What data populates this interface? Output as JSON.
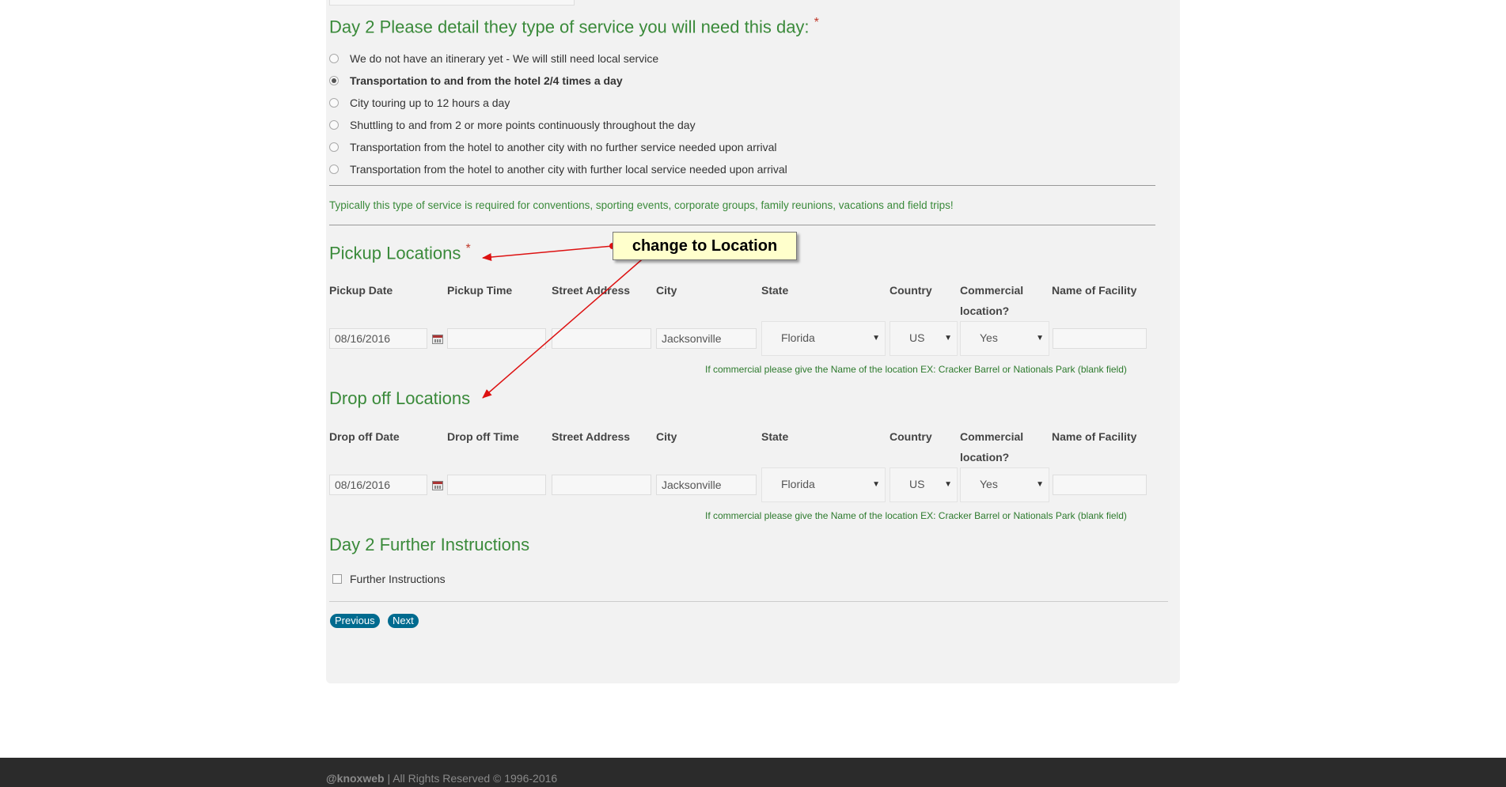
{
  "day_question": {
    "title": "Day 2 Please detail they type of service you will need this day:",
    "required_mark": "*",
    "options": [
      {
        "label": "We do not have an itinerary yet - We will still need local service",
        "selected": false
      },
      {
        "label": "Transportation to and from the hotel 2/4 times a day",
        "selected": true
      },
      {
        "label": "City touring up to 12 hours a day",
        "selected": false
      },
      {
        "label": "Shuttling to and from 2 or more points continuously throughout the day",
        "selected": false
      },
      {
        "label": "Transportation from the hotel to another city with no further service needed upon arrival",
        "selected": false
      },
      {
        "label": "Transportation from the hotel to another city with further local service needed upon arrival",
        "selected": false
      }
    ],
    "note": "Typically this type of service is required for conventions, sporting events, corporate groups, family reunions, vacations and field trips!"
  },
  "pickup": {
    "heading": "Pickup Locations",
    "required_mark": "*",
    "columns": {
      "date": "Pickup Date",
      "time": "Pickup Time",
      "street": "Street Address",
      "city": "City",
      "state": "State",
      "country": "Country",
      "commercial_1": "Commercial",
      "commercial_2": "location?",
      "facility": "Name of Facility"
    },
    "values": {
      "date": "08/16/2016",
      "time": "",
      "street": "",
      "city": "Jacksonville",
      "state": "Florida",
      "country": "US",
      "commercial": "Yes",
      "facility": ""
    },
    "hint": "If commercial please give the Name of the location EX: Cracker Barrel or Nationals Park (blank field)"
  },
  "dropoff": {
    "heading": "Drop off Locations",
    "columns": {
      "date": "Drop off Date",
      "time": "Drop off Time",
      "street": "Street Address",
      "city": "City",
      "state": "State",
      "country": "Country",
      "commercial_1": "Commercial",
      "commercial_2": "location?",
      "facility": "Name of Facility"
    },
    "values": {
      "date": "08/16/2016",
      "time": "",
      "street": "",
      "city": "Jacksonville",
      "state": "Florida",
      "country": "US",
      "commercial": "Yes",
      "facility": ""
    },
    "hint": "If commercial please give the Name of the location EX: Cracker Barrel or Nationals Park (blank field)"
  },
  "further": {
    "heading": "Day 2 Further Instructions",
    "checkbox_label": "Further Instructions",
    "checked": false
  },
  "nav": {
    "previous": "Previous",
    "next": "Next"
  },
  "annotation": {
    "text": "change to Location",
    "color": "#dd1111"
  },
  "footer": {
    "brand": "@knoxweb",
    "rights": "| All Rights Reserved © 1996-2016"
  },
  "colors": {
    "heading_green": "#3a8a3a",
    "button_blue": "#006b8f",
    "footer_bg": "#2b2b2b"
  }
}
